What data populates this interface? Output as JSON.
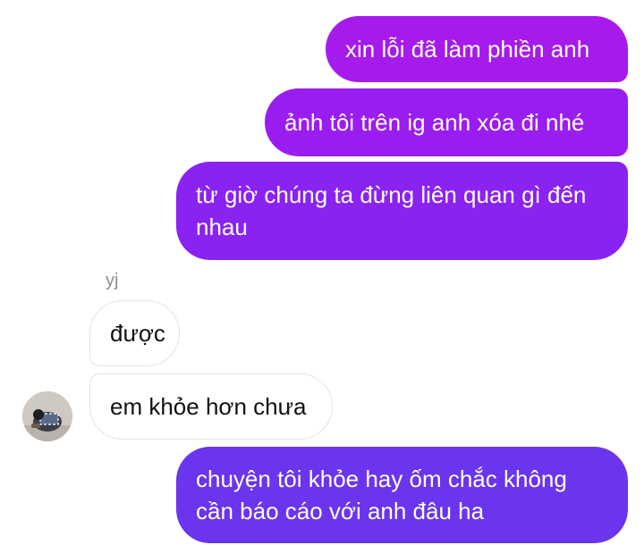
{
  "messages": [
    {
      "id": 1,
      "direction": "outgoing",
      "text": "xin lỗi đã làm phiền anh"
    },
    {
      "id": 2,
      "direction": "outgoing",
      "text": "ảnh tôi trên ig anh xóa đi nhé"
    },
    {
      "id": 3,
      "direction": "outgoing",
      "text": "từ giờ chúng ta đừng liên quan gì đến nhau"
    },
    {
      "id": 4,
      "direction": "incoming",
      "text": "được"
    },
    {
      "id": 5,
      "direction": "incoming",
      "text": "em khỏe hơn chưa"
    },
    {
      "id": 6,
      "direction": "outgoing",
      "text": "chuyện tôi khỏe hay ốm chắc không cần báo cáo với anh đâu ha"
    }
  ],
  "sender": {
    "name": "yj",
    "avatar_icon": "profile-photo"
  },
  "colors": {
    "outgoing_top": "#a61aec",
    "outgoing_bottom": "#6a35ec",
    "incoming_bg": "#ffffff",
    "incoming_border": "#e3e3e3",
    "sender_name": "#8e8e8e"
  }
}
